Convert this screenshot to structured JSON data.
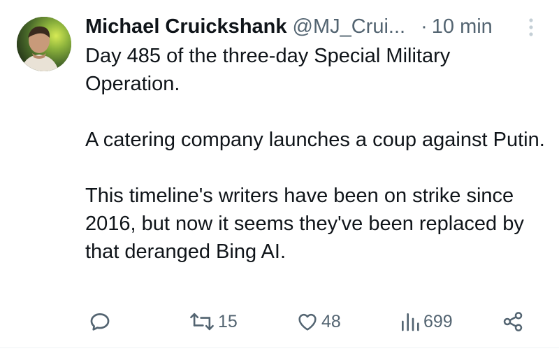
{
  "tweet": {
    "author": {
      "display_name": "Michael Cruickshank",
      "handle": "@MJ_Crui...",
      "avatar_icon": "profile-photo"
    },
    "separator": "·",
    "time": "10 min",
    "paragraphs": [
      "Day 485 of the three-day Special Military Operation.",
      "A catering company launches a coup against Putin.",
      "This timeline's writers have been on strike since 2016, but now it seems they've been replaced by that deranged Bing AI."
    ],
    "actions": {
      "reply": {
        "icon": "reply-icon",
        "count": ""
      },
      "retweet": {
        "icon": "retweet-icon",
        "count": "15"
      },
      "like": {
        "icon": "heart-icon",
        "count": "48"
      },
      "views": {
        "icon": "views-icon",
        "count": "699"
      },
      "share": {
        "icon": "share-icon"
      }
    }
  },
  "colors": {
    "text_primary": "#0f1419",
    "text_secondary": "#536471",
    "background": "#ffffff"
  }
}
